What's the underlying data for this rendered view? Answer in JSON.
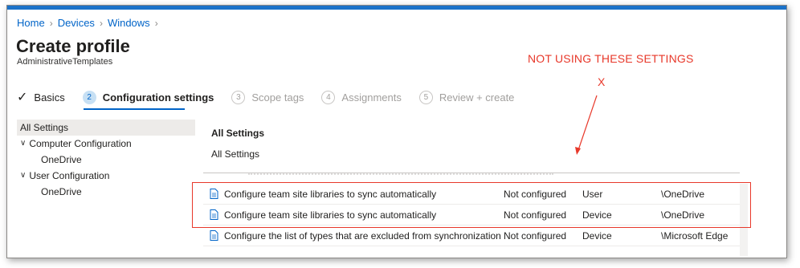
{
  "breadcrumb": [
    "Home",
    "Devices",
    "Windows"
  ],
  "title": "Create profile",
  "subtitle": "AdministrativeTemplates",
  "annotation": {
    "text": "NOT USING THESE SETTINGS",
    "mark": "X",
    "color": "#e8382a"
  },
  "steps": [
    {
      "label": "Basics",
      "state": "done",
      "icon": "check-icon"
    },
    {
      "num": "2",
      "label": "Configuration settings",
      "state": "active"
    },
    {
      "num": "3",
      "label": "Scope tags",
      "state": "future"
    },
    {
      "num": "4",
      "label": "Assignments",
      "state": "future"
    },
    {
      "num": "5",
      "label": "Review + create",
      "state": "future"
    }
  ],
  "tree": [
    {
      "label": "All Settings",
      "selected": true
    },
    {
      "label": "Computer Configuration",
      "expanded": true
    },
    {
      "label": "OneDrive",
      "child": true
    },
    {
      "label": "User Configuration",
      "expanded": true
    },
    {
      "label": "OneDrive",
      "child": true
    }
  ],
  "content": {
    "heading": "All Settings",
    "sub": "All Settings"
  },
  "rows": [
    {
      "name": "Configure team site libraries to sync automatically",
      "state": "Not configured",
      "scope": "User",
      "path": "\\OneDrive"
    },
    {
      "name": "Configure team site libraries to sync automatically",
      "state": "Not configured",
      "scope": "Device",
      "path": "\\OneDrive"
    },
    {
      "name": "Configure the list of types that are excluded from synchronization",
      "state": "Not configured",
      "scope": "Device",
      "path": "\\Microsoft Edge"
    }
  ],
  "colors": {
    "accent": "#0064c8",
    "topbar": "#1b72c9"
  }
}
